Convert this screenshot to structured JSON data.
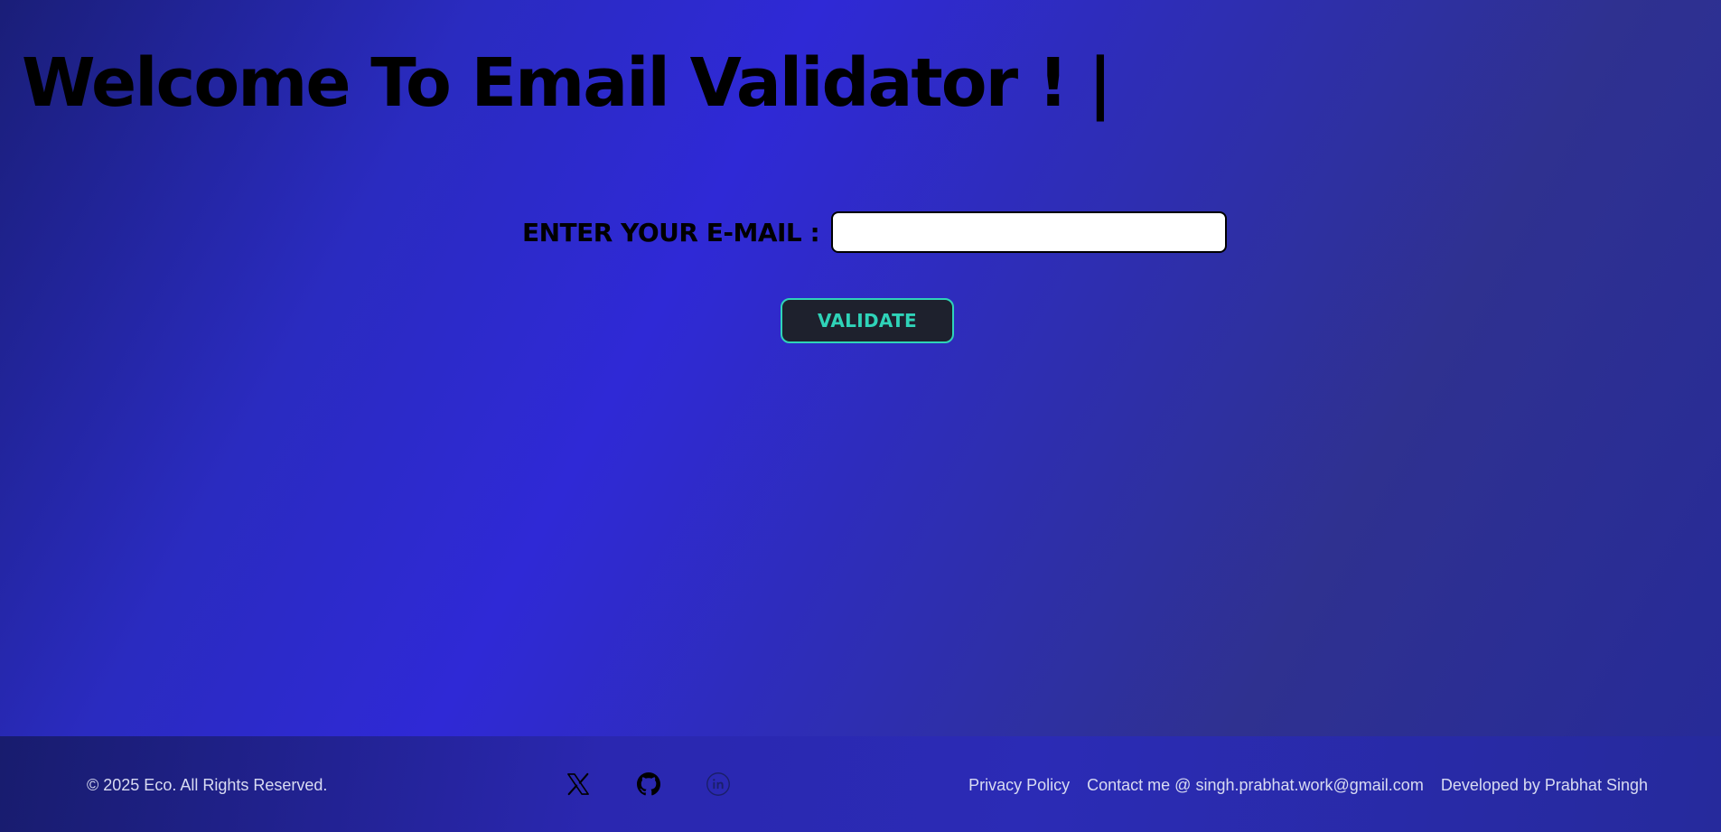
{
  "header": {
    "title": "Welcome To Email Validator ! |"
  },
  "form": {
    "email_label": "ENTER YOUR E-MAIL :",
    "email_value": "",
    "email_placeholder": "",
    "validate_label": "VALIDATE"
  },
  "footer": {
    "copyright": "© 2025 Eco. All Rights Reserved.",
    "social_icons": [
      "x-icon",
      "github-icon",
      "linkedin-icon"
    ],
    "links": {
      "privacy": "Privacy Policy",
      "contact": "Contact me @ singh.prabhat.work@gmail.com",
      "developer": "Developed by Prabhat Singh"
    }
  },
  "colors": {
    "background_accent": "#2f29d6",
    "button_bg": "#1e212d",
    "button_accent": "#2fd3b8",
    "footer_text": "#d8dbf2"
  }
}
